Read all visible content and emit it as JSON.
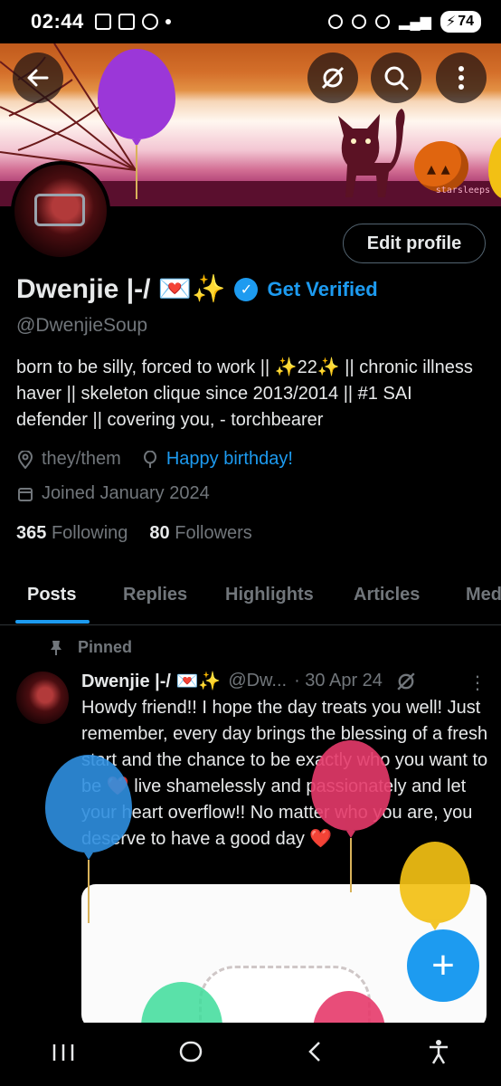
{
  "status_bar": {
    "time": "02:44",
    "battery": "74"
  },
  "banner": {
    "signature": "starsleeps"
  },
  "profile": {
    "display_name": "Dwenjie |-/ 💌✨",
    "verified_check": "✓",
    "get_verified_label": "Get Verified",
    "handle": "@DwenjieSoup",
    "bio": "born to be silly, forced to work || ✨22✨ || chronic illness haver || skeleton clique since 2013/2014 || #1 SAI defender || covering you, - torchbearer",
    "pronouns": "they/them",
    "birthday_label": "Happy birthday!",
    "joined": "Joined January 2024",
    "following_count": "365",
    "following_label": "Following",
    "followers_count": "80",
    "followers_label": "Followers",
    "edit_profile_label": "Edit profile"
  },
  "tabs": [
    {
      "label": "Posts",
      "active": true
    },
    {
      "label": "Replies",
      "active": false
    },
    {
      "label": "Highlights",
      "active": false
    },
    {
      "label": "Articles",
      "active": false
    },
    {
      "label": "Media",
      "active": false
    }
  ],
  "pinned_post": {
    "pinned_label": "Pinned",
    "author_name": "Dwenjie |-/ 💌✨",
    "author_handle": "@Dw...",
    "date": "· 30 Apr 24",
    "text_part1": "Howdy friend!! I hope the day treats you well! Just remember, every day brings the blessing of a fresh start and the chance to be exactly who you want to be",
    "text_part2": "live shamelessly and passionately and let your heart overflow!! No matter who you are, you deserve to have a good day",
    "heart": "❤️"
  },
  "fab_label": "+",
  "icons": {
    "back": "back-arrow-icon",
    "grok": "grok-icon",
    "search": "search-icon",
    "more": "more-vertical-icon",
    "location": "location-pin-icon",
    "balloon": "balloon-icon",
    "calendar": "calendar-icon",
    "pin": "pin-icon"
  },
  "colors": {
    "accent": "#1d9bf0",
    "background": "#000000",
    "muted_text": "#71767b",
    "balloon_purple": "#9b37d8",
    "balloon_blue": "#2f8fe0",
    "balloon_pink": "#e63a6a",
    "balloon_yellow": "#f2c014",
    "balloon_green": "#3ddc9a"
  }
}
